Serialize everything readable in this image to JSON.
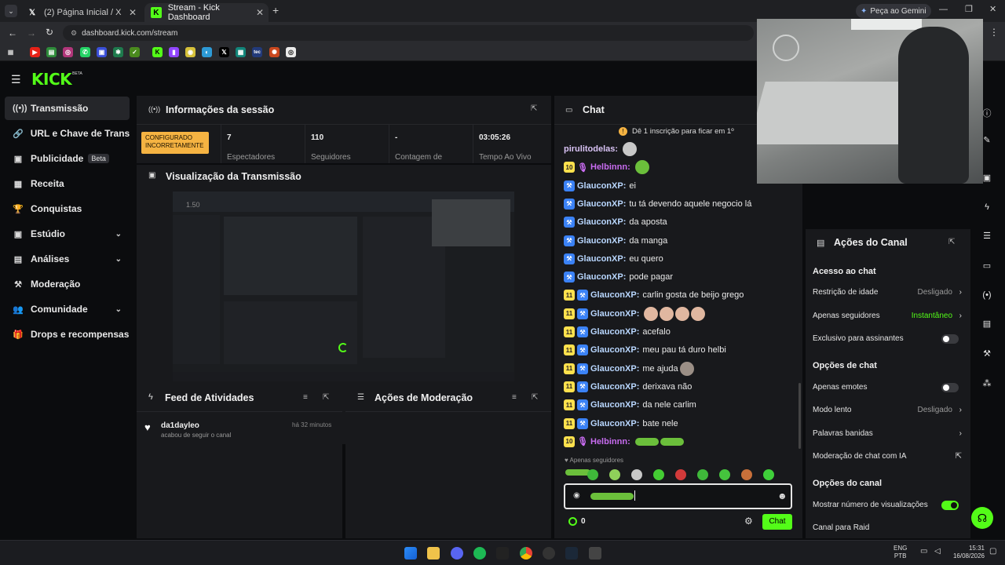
{
  "browser": {
    "tabs": [
      {
        "label": "(2) Página Inicial / X",
        "active": false
      },
      {
        "label": "Stream - Kick Dashboard",
        "active": true
      }
    ],
    "new_tab": "+",
    "gemini_label": "Peça ao Gemini",
    "url": "dashboard.kick.com/stream"
  },
  "logo": "KICK",
  "logo_sup": "BETA",
  "sidebar": {
    "items": [
      {
        "label": "Transmissão",
        "icon": "broadcast-icon",
        "glyph": "((•))",
        "active": true
      },
      {
        "label": "URL e Chave de Transmissão",
        "icon": "link-icon",
        "glyph": "🔗"
      },
      {
        "label": "Publicidade",
        "icon": "ad-icon",
        "glyph": "▣",
        "badge": "Beta"
      },
      {
        "label": "Receita",
        "icon": "revenue-icon",
        "glyph": "▦"
      },
      {
        "label": "Conquistas",
        "icon": "trophy-icon",
        "glyph": "🏆"
      },
      {
        "label": "Estúdio",
        "icon": "studio-icon",
        "glyph": "▣",
        "expandable": true
      },
      {
        "label": "Análises",
        "icon": "analytics-icon",
        "glyph": "▤",
        "expandable": true
      },
      {
        "label": "Moderação",
        "icon": "hammer-icon",
        "glyph": "⚒"
      },
      {
        "label": "Comunidade",
        "icon": "community-icon",
        "glyph": "👥",
        "expandable": true
      },
      {
        "label": "Drops e recompensas",
        "icon": "gift-icon",
        "glyph": "🎁"
      }
    ]
  },
  "session": {
    "title": "Informações da sessão",
    "status": "CONFIGURADO INCORRETAMENTE",
    "stats": [
      {
        "value": "7",
        "label": "Espectadores"
      },
      {
        "value": "110",
        "label": "Seguidores"
      },
      {
        "value": "-",
        "label": "Contagem de"
      },
      {
        "value": "03:05:26",
        "label": "Tempo Ao Vivo"
      }
    ]
  },
  "preview": {
    "title": "Visualização da Transmissão",
    "time": "1.50"
  },
  "feed": {
    "title": "Feed de Atividades",
    "items": [
      {
        "user": "da1dayleo",
        "text": "acabou de seguir o canal",
        "time": "há 32 minutos"
      }
    ]
  },
  "mod_actions": {
    "title": "Ações de Moderação"
  },
  "chat": {
    "title": "Chat",
    "notice": "Dê 1 inscrição para ficar em 1º",
    "messages": [
      {
        "badge": "",
        "mic": false,
        "mod": false,
        "user": "pirulitodelas",
        "sep": ":",
        "text": "",
        "emotes": 1,
        "ucolor": "#d9c3f5"
      },
      {
        "badge": "10",
        "mic": true,
        "mod": false,
        "user": "Helbinnn",
        "sep": ":",
        "text": "",
        "emotes": 1,
        "ucolor": "#c86cf0"
      },
      {
        "badge": "",
        "mic": false,
        "mod": true,
        "user": "GlauconXP",
        "sep": ":",
        "text": "ei",
        "emotes": 0,
        "ucolor": "#b9d7ff"
      },
      {
        "badge": "",
        "mic": false,
        "mod": true,
        "user": "GlauconXP",
        "sep": ":",
        "text": "tu tá devendo aquele negocio lá",
        "emotes": 0,
        "ucolor": "#b9d7ff"
      },
      {
        "badge": "",
        "mic": false,
        "mod": true,
        "user": "GlauconXP",
        "sep": ":",
        "text": "da aposta",
        "emotes": 0,
        "ucolor": "#b9d7ff"
      },
      {
        "badge": "",
        "mic": false,
        "mod": true,
        "user": "GlauconXP",
        "sep": ":",
        "text": "da manga",
        "emotes": 0,
        "ucolor": "#b9d7ff"
      },
      {
        "badge": "",
        "mic": false,
        "mod": true,
        "user": "GlauconXP",
        "sep": ":",
        "text": "eu quero",
        "emotes": 0,
        "ucolor": "#b9d7ff"
      },
      {
        "badge": "",
        "mic": false,
        "mod": true,
        "user": "GlauconXP",
        "sep": ":",
        "text": "pode pagar",
        "emotes": 0,
        "ucolor": "#b9d7ff"
      },
      {
        "badge": "11",
        "mic": false,
        "mod": true,
        "user": "GlauconXP",
        "sep": ":",
        "text": "carlin gosta de beijo grego",
        "emotes": 0,
        "ucolor": "#b9d7ff"
      },
      {
        "badge": "11",
        "mic": false,
        "mod": true,
        "user": "GlauconXP",
        "sep": ":",
        "text": "",
        "emotes": 4,
        "ucolor": "#b9d7ff"
      },
      {
        "badge": "11",
        "mic": false,
        "mod": true,
        "user": "GlauconXP",
        "sep": ":",
        "text": "acefalo",
        "emotes": 0,
        "ucolor": "#b9d7ff"
      },
      {
        "badge": "11",
        "mic": false,
        "mod": true,
        "user": "GlauconXP",
        "sep": ":",
        "text": "meu pau tá duro helbi",
        "emotes": 0,
        "ucolor": "#b9d7ff"
      },
      {
        "badge": "11",
        "mic": false,
        "mod": true,
        "user": "GlauconXP",
        "sep": ":",
        "text": "me ajuda",
        "emotes": 1,
        "ucolor": "#b9d7ff"
      },
      {
        "badge": "11",
        "mic": false,
        "mod": true,
        "user": "GlauconXP",
        "sep": ":",
        "text": "derixava não",
        "emotes": 0,
        "ucolor": "#b9d7ff"
      },
      {
        "badge": "11",
        "mic": false,
        "mod": true,
        "user": "GlauconXP",
        "sep": ":",
        "text": "da nele carlim",
        "emotes": 0,
        "ucolor": "#b9d7ff"
      },
      {
        "badge": "11",
        "mic": false,
        "mod": true,
        "user": "GlauconXP",
        "sep": ":",
        "text": "bate nele",
        "emotes": 0,
        "ucolor": "#b9d7ff"
      },
      {
        "badge": "10",
        "mic": true,
        "mod": false,
        "user": "Helbinnn",
        "sep": ":",
        "text": "",
        "emotes": 2,
        "ucolor": "#c86cf0"
      }
    ],
    "followers_only": "Apenas seguidores",
    "send_label": "Chat",
    "points": "0"
  },
  "channel_actions": {
    "title": "Ações do Canal",
    "sections": [
      {
        "title": "Acesso ao chat",
        "rows": [
          {
            "label": "Restrição de idade",
            "value": "Desligado",
            "type": "link"
          },
          {
            "label": "Apenas seguidores",
            "value": "Instantâneo",
            "type": "link",
            "green": true
          },
          {
            "label": "Exclusivo para assinantes",
            "value": "",
            "type": "toggle",
            "on": false
          }
        ]
      },
      {
        "title": "Opções de chat",
        "rows": [
          {
            "label": "Apenas emotes",
            "value": "",
            "type": "toggle",
            "on": false
          },
          {
            "label": "Modo lento",
            "value": "Desligado",
            "type": "link"
          },
          {
            "label": "Palavras banidas",
            "value": "",
            "type": "link"
          },
          {
            "label": "Moderação de chat com IA",
            "value": "",
            "type": "external"
          }
        ]
      },
      {
        "title": "Opções do canal",
        "rows": [
          {
            "label": "Mostrar número de visualizações",
            "value": "",
            "type": "toggle",
            "on": true
          },
          {
            "label": "Canal para Raid",
            "value": "",
            "type": "none"
          }
        ]
      }
    ]
  },
  "taskbar": {
    "lang": "ENG",
    "layout": "PTB",
    "time": "15:31",
    "date": "16/08/2026"
  },
  "colors": {
    "accent": "#53fc18",
    "bg": "#0b0c0e",
    "panel": "#18191c",
    "warning": "#f5b342"
  }
}
